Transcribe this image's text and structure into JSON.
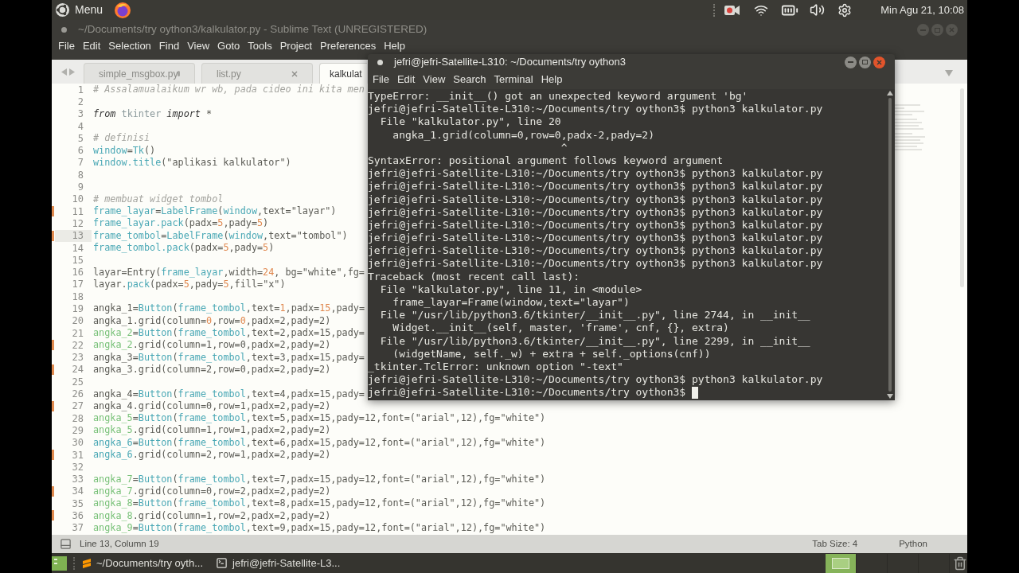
{
  "top_panel": {
    "menu_label": "Menu",
    "clock": "Min Agu 21, 10:08"
  },
  "editor_window": {
    "title": "~/Documents/try oython3/kalkulator.py - Sublime Text (UNREGISTERED)",
    "menu": [
      "File",
      "Edit",
      "Selection",
      "Find",
      "View",
      "Goto",
      "Tools",
      "Project",
      "Preferences",
      "Help"
    ],
    "tabs": [
      {
        "label": "simple_msgbox.py",
        "kind": "dirty",
        "selected": false
      },
      {
        "label": "list.py",
        "kind": "close",
        "selected": false
      },
      {
        "label": "kalkulat",
        "kind": "plain",
        "selected": true
      }
    ],
    "lines": [
      {
        "number": "1",
        "modified": false,
        "current": false,
        "tokens": [
          {
            "kind": "comment",
            "text": "# Assalamualaikum wr wb, pada cideo ini kita men"
          }
        ]
      },
      {
        "number": "2",
        "modified": false,
        "current": false
      },
      {
        "number": "3",
        "modified": false,
        "current": false,
        "tokens": [
          {
            "kind": "keyword",
            "text": "from"
          },
          {
            "kind": "module",
            "text": " tkinter "
          },
          {
            "kind": "keyword",
            "text": "import"
          },
          {
            "kind": "plain",
            "text": " *"
          }
        ]
      },
      {
        "number": "4",
        "modified": false,
        "current": false
      },
      {
        "number": "5",
        "modified": false,
        "current": false,
        "tokens": [
          {
            "kind": "comment",
            "text": "# definisi"
          }
        ]
      },
      {
        "number": "6",
        "modified": false,
        "current": false,
        "tokens": [
          {
            "kind": "name",
            "text": "window"
          },
          {
            "kind": "plain",
            "text": "="
          },
          {
            "kind": "name",
            "text": "Tk"
          },
          {
            "kind": "plain",
            "text": "()"
          }
        ]
      },
      {
        "number": "7",
        "modified": false,
        "current": false,
        "tokens": [
          {
            "kind": "name",
            "text": "window.title"
          },
          {
            "kind": "plain",
            "text": "(\"aplikasi kalkulator\")"
          }
        ]
      },
      {
        "number": "8",
        "modified": false,
        "current": false
      },
      {
        "number": "9",
        "modified": false,
        "current": false
      },
      {
        "number": "10",
        "modified": false,
        "current": false,
        "tokens": [
          {
            "kind": "comment",
            "text": "# membuat widget tombol"
          }
        ]
      },
      {
        "number": "11",
        "modified": true,
        "current": false,
        "tokens": [
          {
            "kind": "name",
            "text": "frame_layar"
          },
          {
            "kind": "plain",
            "text": "="
          },
          {
            "kind": "name",
            "text": "LabelFrame"
          },
          {
            "kind": "plain",
            "text": "("
          },
          {
            "kind": "name",
            "text": "window"
          },
          {
            "kind": "plain",
            "text": ",text=\"layar\")"
          }
        ]
      },
      {
        "number": "12",
        "modified": false,
        "current": false,
        "tokens": [
          {
            "kind": "name",
            "text": "frame_layar.pack"
          },
          {
            "kind": "plain",
            "text": "(padx="
          },
          {
            "kind": "number",
            "text": "5"
          },
          {
            "kind": "plain",
            "text": ",pady="
          },
          {
            "kind": "number",
            "text": "5"
          },
          {
            "kind": "plain",
            "text": ")"
          }
        ]
      },
      {
        "number": "13",
        "modified": true,
        "current": true,
        "tokens": [
          {
            "kind": "name",
            "text": "frame_tombol"
          },
          {
            "kind": "plain",
            "text": "="
          },
          {
            "kind": "name",
            "text": "LabelFrame"
          },
          {
            "kind": "plain",
            "text": "("
          },
          {
            "kind": "name",
            "text": "window"
          },
          {
            "kind": "plain",
            "text": ",text=\"tombol\")"
          }
        ]
      },
      {
        "number": "14",
        "modified": false,
        "current": false,
        "tokens": [
          {
            "kind": "name",
            "text": "frame_tombol.pack"
          },
          {
            "kind": "plain",
            "text": "(padx="
          },
          {
            "kind": "number",
            "text": "5"
          },
          {
            "kind": "plain",
            "text": ",pady="
          },
          {
            "kind": "number",
            "text": "5"
          },
          {
            "kind": "plain",
            "text": ")"
          }
        ]
      },
      {
        "number": "15",
        "modified": false,
        "current": false
      },
      {
        "number": "16",
        "modified": false,
        "current": false,
        "tokens": [
          {
            "kind": "plain",
            "text": "layar=Entry("
          },
          {
            "kind": "name",
            "text": "frame_layar"
          },
          {
            "kind": "plain",
            "text": ",width="
          },
          {
            "kind": "number",
            "text": "24"
          },
          {
            "kind": "plain",
            "text": ", bg=\"white\",fg="
          }
        ]
      },
      {
        "number": "17",
        "modified": false,
        "current": false,
        "tokens": [
          {
            "kind": "plain",
            "text": "layar."
          },
          {
            "kind": "name",
            "text": "pack"
          },
          {
            "kind": "plain",
            "text": "(padx="
          },
          {
            "kind": "number",
            "text": "5"
          },
          {
            "kind": "plain",
            "text": ",pady="
          },
          {
            "kind": "number",
            "text": "5"
          },
          {
            "kind": "plain",
            "text": ",fill=\"x\")"
          }
        ]
      },
      {
        "number": "18",
        "modified": false,
        "current": false
      },
      {
        "number": "19",
        "modified": false,
        "current": false,
        "tokens": [
          {
            "kind": "plain",
            "text": "angka_1="
          },
          {
            "kind": "name",
            "text": "Button"
          },
          {
            "kind": "plain",
            "text": "("
          },
          {
            "kind": "name",
            "text": "frame_tombol"
          },
          {
            "kind": "plain",
            "text": ",text="
          },
          {
            "kind": "number",
            "text": "1"
          },
          {
            "kind": "plain",
            "text": ",padx="
          },
          {
            "kind": "number",
            "text": "15"
          },
          {
            "kind": "plain",
            "text": ",pady="
          }
        ]
      },
      {
        "number": "20",
        "modified": false,
        "current": false,
        "tokens": [
          {
            "kind": "plain",
            "text": "angka_1.grid(column="
          },
          {
            "kind": "number",
            "text": "0"
          },
          {
            "kind": "plain",
            "text": ",row="
          },
          {
            "kind": "number",
            "text": "0"
          },
          {
            "kind": "plain",
            "text": ",padx=2,pady=2)"
          }
        ]
      },
      {
        "number": "21",
        "modified": false,
        "current": false,
        "tokens": [
          {
            "kind": "var",
            "text": "angka_2"
          },
          {
            "kind": "plain",
            "text": "="
          },
          {
            "kind": "name",
            "text": "Button"
          },
          {
            "kind": "plain",
            "text": "("
          },
          {
            "kind": "name",
            "text": "frame_tombol"
          },
          {
            "kind": "plain",
            "text": ",text=2,padx=15,pady="
          }
        ]
      },
      {
        "number": "22",
        "modified": true,
        "current": false,
        "tokens": [
          {
            "kind": "var",
            "text": "angka_2"
          },
          {
            "kind": "plain",
            "text": ".grid(column=1,row=0,padx=2,pady=2)"
          }
        ]
      },
      {
        "number": "23",
        "modified": false,
        "current": false,
        "tokens": [
          {
            "kind": "plain",
            "text": "angka_3="
          },
          {
            "kind": "name",
            "text": "Button"
          },
          {
            "kind": "plain",
            "text": "("
          },
          {
            "kind": "name",
            "text": "frame_tombol"
          },
          {
            "kind": "plain",
            "text": ",text=3,padx=15,pady="
          }
        ]
      },
      {
        "number": "24",
        "modified": true,
        "current": false,
        "tokens": [
          {
            "kind": "plain",
            "text": "angka_3.grid(column=2,row=0,padx=2,pady=2)"
          }
        ]
      },
      {
        "number": "25",
        "modified": false,
        "current": false
      },
      {
        "number": "26",
        "modified": false,
        "current": false,
        "tokens": [
          {
            "kind": "plain",
            "text": "angka_4="
          },
          {
            "kind": "name",
            "text": "Button"
          },
          {
            "kind": "plain",
            "text": "("
          },
          {
            "kind": "name",
            "text": "frame_tombol"
          },
          {
            "kind": "plain",
            "text": ",text=4,padx=15,pady="
          }
        ]
      },
      {
        "number": "27",
        "modified": true,
        "current": false,
        "tokens": [
          {
            "kind": "plain",
            "text": "angka_4.grid(column=0,row=1,padx=2,pady=2)"
          }
        ]
      },
      {
        "number": "28",
        "modified": false,
        "current": false,
        "tokens": [
          {
            "kind": "var",
            "text": "angka_5"
          },
          {
            "kind": "plain",
            "text": "="
          },
          {
            "kind": "name",
            "text": "Button"
          },
          {
            "kind": "plain",
            "text": "("
          },
          {
            "kind": "name",
            "text": "frame_tombol"
          },
          {
            "kind": "plain",
            "text": ",text=5,padx=15,pady=12,font=(\"arial\",12),fg=\"white\")"
          }
        ]
      },
      {
        "number": "29",
        "modified": false,
        "current": false,
        "tokens": [
          {
            "kind": "var",
            "text": "angka_5"
          },
          {
            "kind": "plain",
            "text": ".grid(column=1,row=1,padx=2,pady=2)"
          }
        ]
      },
      {
        "number": "30",
        "modified": false,
        "current": false,
        "tokens": [
          {
            "kind": "name",
            "text": "angka_6"
          },
          {
            "kind": "plain",
            "text": "="
          },
          {
            "kind": "name",
            "text": "Button"
          },
          {
            "kind": "plain",
            "text": "("
          },
          {
            "kind": "name",
            "text": "frame_tombol"
          },
          {
            "kind": "plain",
            "text": ",text=6,padx=15,pady=12,font=(\"arial\",12),fg=\"white\")"
          }
        ]
      },
      {
        "number": "31",
        "modified": true,
        "current": false,
        "tokens": [
          {
            "kind": "name",
            "text": "angka_6"
          },
          {
            "kind": "plain",
            "text": ".grid(column=2,row=1,padx=2,pady=2)"
          }
        ]
      },
      {
        "number": "32",
        "modified": false,
        "current": false
      },
      {
        "number": "33",
        "modified": false,
        "current": false,
        "tokens": [
          {
            "kind": "var",
            "text": "angka_7"
          },
          {
            "kind": "plain",
            "text": "="
          },
          {
            "kind": "name",
            "text": "Button"
          },
          {
            "kind": "plain",
            "text": "("
          },
          {
            "kind": "name",
            "text": "frame_tombol"
          },
          {
            "kind": "plain",
            "text": ",text=7,padx=15,pady=12,font=(\"arial\",12),fg=\"white\")"
          }
        ]
      },
      {
        "number": "34",
        "modified": true,
        "current": false,
        "tokens": [
          {
            "kind": "var",
            "text": "angka_7"
          },
          {
            "kind": "plain",
            "text": ".grid(column=0,row=2,padx=2,pady=2)"
          }
        ]
      },
      {
        "number": "35",
        "modified": false,
        "current": false,
        "tokens": [
          {
            "kind": "var",
            "text": "angka_8"
          },
          {
            "kind": "plain",
            "text": "="
          },
          {
            "kind": "name",
            "text": "Button"
          },
          {
            "kind": "plain",
            "text": "("
          },
          {
            "kind": "name",
            "text": "frame_tombol"
          },
          {
            "kind": "plain",
            "text": ",text=8,padx=15,pady=12,font=(\"arial\",12),fg=\"white\")"
          }
        ]
      },
      {
        "number": "36",
        "modified": true,
        "current": false,
        "tokens": [
          {
            "kind": "var",
            "text": "angka_8"
          },
          {
            "kind": "plain",
            "text": ".grid(column=1,row=2,padx=2,pady=2)"
          }
        ]
      },
      {
        "number": "37",
        "modified": false,
        "current": false,
        "tokens": [
          {
            "kind": "var",
            "text": "angka_9"
          },
          {
            "kind": "plain",
            "text": "="
          },
          {
            "kind": "name",
            "text": "Button"
          },
          {
            "kind": "plain",
            "text": "("
          },
          {
            "kind": "name",
            "text": "frame_tombol"
          },
          {
            "kind": "plain",
            "text": ",text=9,padx=15,pady=12,font=(\"arial\",12),fg=\"white\")"
          }
        ]
      }
    ],
    "status_bar": {
      "position": "Line 13, Column 19",
      "tab_size": "Tab Size: 4",
      "syntax": "Python"
    }
  },
  "terminal_window": {
    "title": "jefri@jefri-Satellite-L310: ~/Documents/try oython3",
    "menu": [
      "File",
      "Edit",
      "View",
      "Search",
      "Terminal",
      "Help"
    ],
    "lines": [
      "TypeError: __init__() got an unexpected keyword argument 'bg'",
      "jefri@jefri-Satellite-L310:~/Documents/try oython3$ python3 kalkulator.py",
      "  File \"kalkulator.py\", line 20",
      "    angka_1.grid(column=0,row=0,padx-2,pady=2)",
      "                               ^",
      "SyntaxError: positional argument follows keyword argument",
      "jefri@jefri-Satellite-L310:~/Documents/try oython3$ python3 kalkulator.py",
      "jefri@jefri-Satellite-L310:~/Documents/try oython3$ python3 kalkulator.py",
      "jefri@jefri-Satellite-L310:~/Documents/try oython3$ python3 kalkulator.py",
      "jefri@jefri-Satellite-L310:~/Documents/try oython3$ python3 kalkulator.py",
      "jefri@jefri-Satellite-L310:~/Documents/try oython3$ python3 kalkulator.py",
      "jefri@jefri-Satellite-L310:~/Documents/try oython3$ python3 kalkulator.py",
      "jefri@jefri-Satellite-L310:~/Documents/try oython3$ python3 kalkulator.py",
      "jefri@jefri-Satellite-L310:~/Documents/try oython3$ python3 kalkulator.py",
      "Traceback (most recent call last):",
      "  File \"kalkulator.py\", line 11, in <module>",
      "    frame_layar=Frame(window,text=\"layar\")",
      "  File \"/usr/lib/python3.6/tkinter/__init__.py\", line 2744, in __init__",
      "    Widget.__init__(self, master, 'frame', cnf, {}, extra)",
      "  File \"/usr/lib/python3.6/tkinter/__init__.py\", line 2299, in __init__",
      "    (widgetName, self._w) + extra + self._options(cnf))",
      "_tkinter.TclError: unknown option \"-text\"",
      "jefri@jefri-Satellite-L310:~/Documents/try oython3$ python3 kalkulator.py",
      "jefri@jefri-Satellite-L310:~/Documents/try oython3$"
    ],
    "cursor": true
  },
  "taskbar": {
    "items": [
      {
        "label": "~/Documents/try oyth...",
        "kind": "editor"
      },
      {
        "label": "jefri@jefri-Satellite-L3...",
        "kind": "terminal"
      }
    ],
    "workspaces": [
      {
        "selected": true
      },
      {
        "selected": false
      },
      {
        "selected": false
      },
      {
        "selected": false
      }
    ]
  }
}
